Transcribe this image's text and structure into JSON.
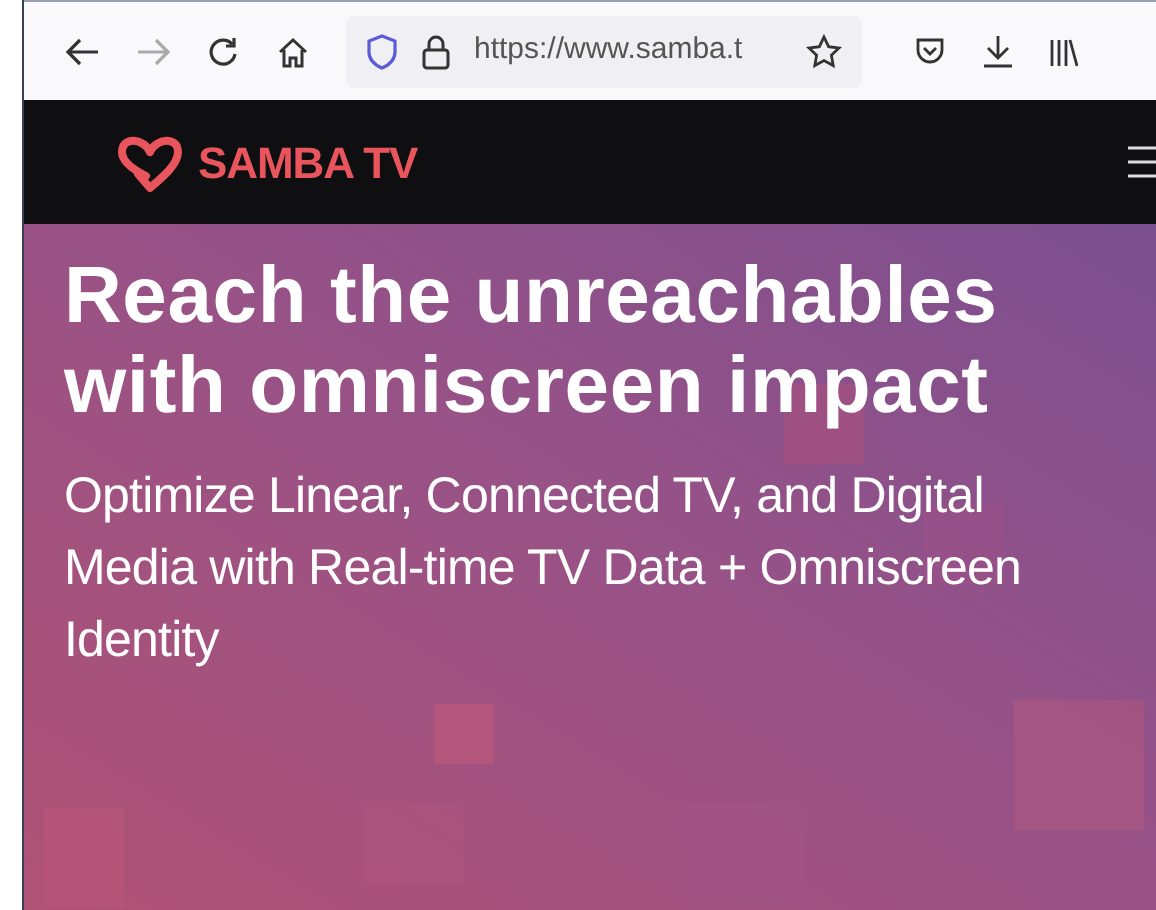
{
  "browser": {
    "url": "https://www.samba.t"
  },
  "site_header": {
    "logo_text": "SAMBA TV"
  },
  "hero": {
    "title_lines": [
      "Reach the unreachables",
      "with omniscreen impact"
    ],
    "subtitle": "Optimize Linear, Connected TV, and Digital Media with Real-time TV Data + Omniscreen Identity"
  }
}
